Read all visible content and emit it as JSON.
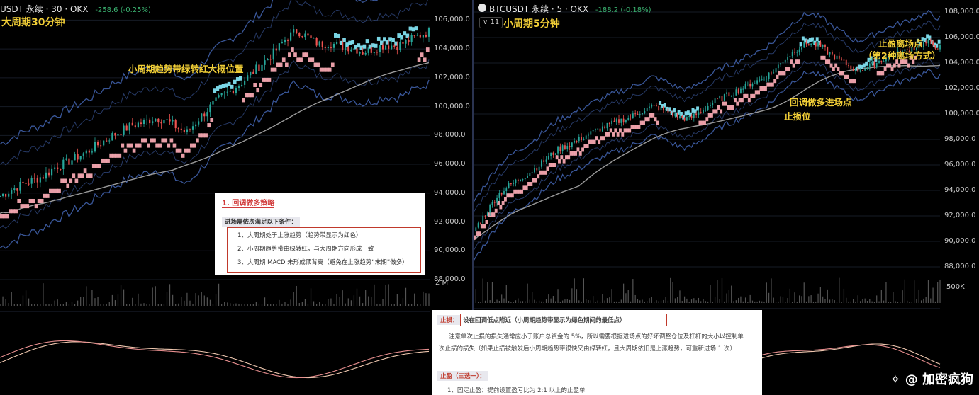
{
  "left_panel": {
    "header": "USDT 永续 · 30 · OKX",
    "change": "-258.6 (-0.25%)",
    "timeframe_label": "大周期30分钟",
    "annotation": "小周期趋势带绿转红大概位置",
    "volume_label": "2 M",
    "y_ticks": [
      "106,000.0",
      "104,000.0",
      "102,000.0",
      "100,000.0",
      "98,000.0",
      "96,000.0",
      "94,000.0",
      "92,000.0",
      "90,000.0",
      "88,000.0"
    ]
  },
  "right_panel": {
    "header": "BTCUSDT 永续 · 5 · OKX",
    "change": "-188.2 (-0.18%)",
    "interval_badge": "11",
    "timeframe_label": "小周期5分钟",
    "annotations": {
      "take_profit": "止盈离场点",
      "take_profit_sub": "（第2种离场方式）",
      "entry": "回调做多进场点",
      "stop": "止损位"
    },
    "volume_label": "500K",
    "y_ticks": [
      "108,000.0",
      "106,000.0",
      "104,000.0",
      "102,000.0",
      "100,000.0",
      "98,000.0",
      "96,000.0",
      "94,000.0",
      "92,000.0",
      "90,000.0",
      "88,000.0"
    ],
    "osc_ticks": [
      "800.0",
      "400.0"
    ]
  },
  "strategy_card": {
    "title": "1. 回调做多策略",
    "conditions_header": "进场需依次满足以下条件：",
    "conditions": [
      "1、大周期处于上涨趋势（趋势带显示为红色）",
      "2、小周期趋势带由绿转红，与大周期方向形成一致",
      "3、大周期 MACD 未形成顶背离（避免在上涨趋势“末期”做多）"
    ]
  },
  "stop_card": {
    "stop_label": "止损：",
    "stop_text": "设在回调低点附近（小周期趋势带显示为绿色期间的最低点）",
    "note_line1": "注意单次止损的损失通常应小于账户总资金的 5%，所以需要根据进场点的好坏调整仓位及杠杆的大小以控制单",
    "note_line2": "次止损的损失（如果止损被触发后小周期趋势带很快又由绿转红，且大周期依旧是上涨趋势，可重新进场 1 次）",
    "tp_label": "止盈（三选一）：",
    "tp_item": "1、固定止盈：提前设置盈亏比为 2:1 以上的止盈单"
  },
  "watermark": "✧ @ 加密疯狗",
  "colors": {
    "up": "#26a69a",
    "down": "#ef5350",
    "band_red": "#f4a6b0",
    "band_green": "#7fe0f0",
    "channel": "#3f5fa8",
    "ma": "#9a9a9a",
    "accent": "#f2cf37"
  },
  "chart_data": [
    {
      "type": "line",
      "title": "USDT 永续 · 30 · OKX",
      "ylim": [
        88000,
        107000
      ],
      "series": [
        {
          "values": [
            93800,
            94200,
            94600,
            94900,
            95200,
            95800,
            96100,
            96500,
            96900,
            97400,
            97900,
            98300,
            98700,
            98900,
            99200,
            99100,
            98600,
            98200,
            99100,
            99900,
            100600,
            101100,
            101700,
            102400,
            103100,
            103800,
            104700,
            105300,
            104800,
            104300,
            104400,
            104200,
            104100,
            103800,
            104000,
            104300,
            104200,
            104500,
            104900,
            105200
          ]
        }
      ]
    },
    {
      "type": "line",
      "title": "BTCUSDT 永续 · 5 · OKX",
      "ylim": [
        87000,
        108500
      ],
      "series": [
        {
          "values": [
            90800,
            92200,
            93600,
            94400,
            95000,
            95600,
            96400,
            97200,
            97600,
            98100,
            98600,
            99000,
            99400,
            99700,
            100200,
            100600,
            100300,
            99800,
            99600,
            100200,
            100900,
            101400,
            101800,
            102300,
            102700,
            103300,
            104300,
            105100,
            105600,
            105300,
            104600,
            104000,
            103400,
            103700,
            104200,
            104600,
            104900,
            105300,
            105600,
            105200
          ]
        }
      ]
    }
  ]
}
